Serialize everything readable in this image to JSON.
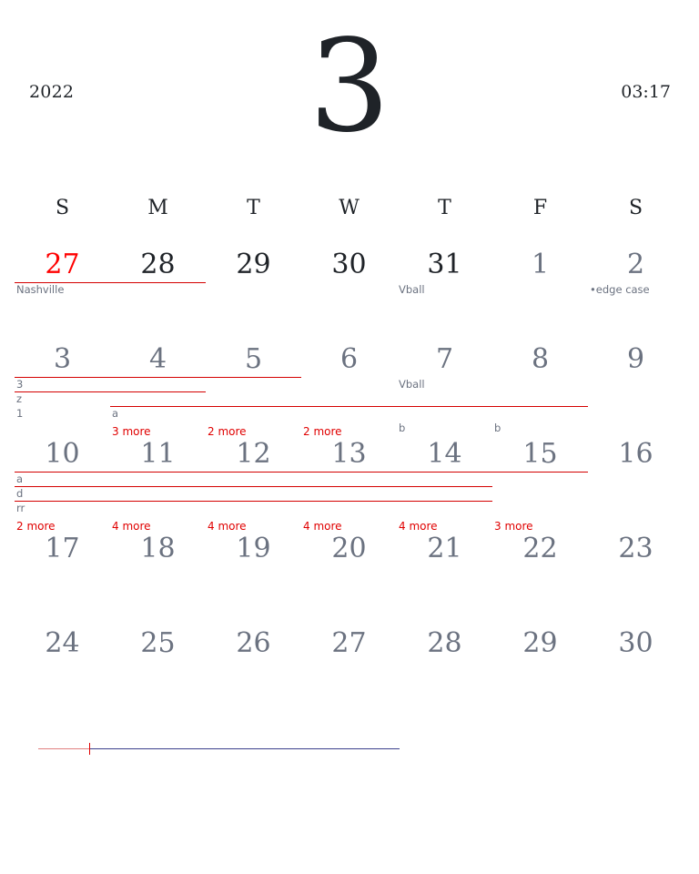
{
  "header": {
    "year": "2022",
    "month_number": "3",
    "time": "03:17"
  },
  "weekdays": [
    "S",
    "M",
    "T",
    "W",
    "T",
    "F",
    "S"
  ],
  "weeks": [
    [
      "27",
      "28",
      "29",
      "30",
      "31",
      "1",
      "2"
    ],
    [
      "3",
      "4",
      "5",
      "6",
      "7",
      "8",
      "9"
    ],
    [
      "10",
      "11",
      "12",
      "13",
      "14",
      "15",
      "16"
    ],
    [
      "17",
      "18",
      "19",
      "20",
      "21",
      "22",
      "23"
    ],
    [
      "24",
      "25",
      "26",
      "27",
      "28",
      "29",
      "30"
    ]
  ],
  "today": {
    "week": 0,
    "day": 0
  },
  "current_month_range": {
    "week": 0,
    "from_day": 1,
    "to_day": 4
  },
  "colors": {
    "today": "#ff0000",
    "event_line": "#d40000",
    "more": "#e00000",
    "current_day": "#1f2328",
    "other_day": "#6b7280"
  },
  "events": [
    {
      "label": "Nashville",
      "week": 0,
      "start": 0,
      "end": 1,
      "lane": 0,
      "line": true
    },
    {
      "label": "Vball",
      "week": 0,
      "start": 4,
      "end": 4,
      "lane": 0,
      "line": false
    },
    {
      "label": "•edge case",
      "week": 0,
      "start": 6,
      "end": 6,
      "lane": 0,
      "line": false
    },
    {
      "label": "3",
      "week": 1,
      "start": 0,
      "end": 2,
      "lane": 0,
      "line": true
    },
    {
      "label": "Vball",
      "week": 1,
      "start": 4,
      "end": 4,
      "lane": 0,
      "line": false
    },
    {
      "label": "z",
      "week": 1,
      "start": 0,
      "end": 1,
      "lane": 1,
      "line": true
    },
    {
      "label": "1",
      "week": 1,
      "start": 0,
      "end": 0,
      "lane": 2,
      "line": false
    },
    {
      "label": "a",
      "week": 1,
      "start": 1,
      "end": 5,
      "lane": 2,
      "line": true
    },
    {
      "label": "b",
      "week": 1,
      "start": 4,
      "end": 4,
      "lane": 3,
      "line": false
    },
    {
      "label": "b",
      "week": 1,
      "start": 5,
      "end": 5,
      "lane": 3,
      "line": false
    },
    {
      "label": "a",
      "week": 2,
      "start": 0,
      "end": 5,
      "lane": 0,
      "line": true
    },
    {
      "label": "d",
      "week": 2,
      "start": 0,
      "end": 4,
      "lane": 1,
      "line": true
    },
    {
      "label": "rr",
      "week": 2,
      "start": 0,
      "end": 4,
      "lane": 2,
      "line": true
    }
  ],
  "more_links": [
    {
      "label": "3 more",
      "week": 1,
      "day": 1
    },
    {
      "label": "2 more",
      "week": 1,
      "day": 2
    },
    {
      "label": "2 more",
      "week": 1,
      "day": 3
    },
    {
      "label": "2 more",
      "week": 2,
      "day": 0
    },
    {
      "label": "4 more",
      "week": 2,
      "day": 1
    },
    {
      "label": "4 more",
      "week": 2,
      "day": 2
    },
    {
      "label": "4 more",
      "week": 2,
      "day": 3
    },
    {
      "label": "4 more",
      "week": 2,
      "day": 4
    },
    {
      "label": "3 more",
      "week": 2,
      "day": 5
    }
  ],
  "month_progress": 0.14
}
